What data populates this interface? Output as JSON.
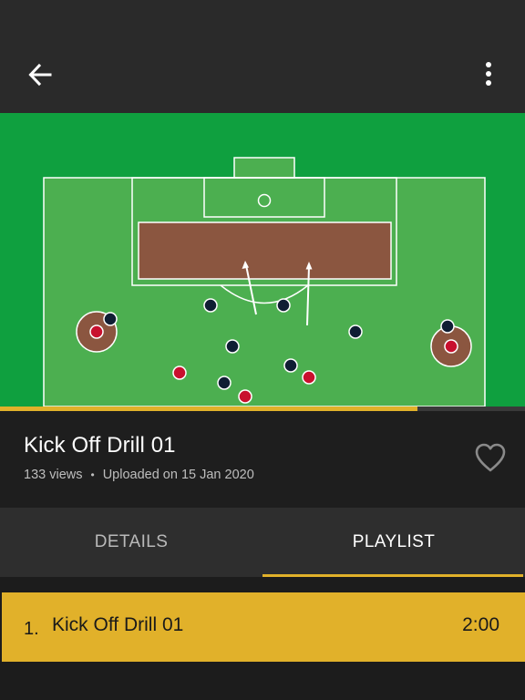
{
  "appbar": {
    "back_icon": "arrow-left-icon",
    "menu_icon": "more-vert-icon"
  },
  "drill_diagram": {
    "field_color": "#0fa03f",
    "pitch_color": "#4caf50",
    "zone_color": "#8b5640",
    "team_a_color": "#0f1e33",
    "team_b_color": "#c8102e"
  },
  "player": {
    "progress": 0.795,
    "progress_color": "#e1b12a"
  },
  "video": {
    "title": "Kick Off Drill 01",
    "views": "133 views",
    "separator": "•",
    "uploaded": "Uploaded on 15 Jan 2020",
    "favorite_icon": "heart-outline-icon"
  },
  "tabs": [
    {
      "label": "DETAILS",
      "active": false
    },
    {
      "label": "PLAYLIST",
      "active": true
    }
  ],
  "playlist": [
    {
      "index": "1.",
      "title": "Kick Off Drill 01",
      "duration": "2:00"
    }
  ],
  "accent_color": "#e1b12a"
}
